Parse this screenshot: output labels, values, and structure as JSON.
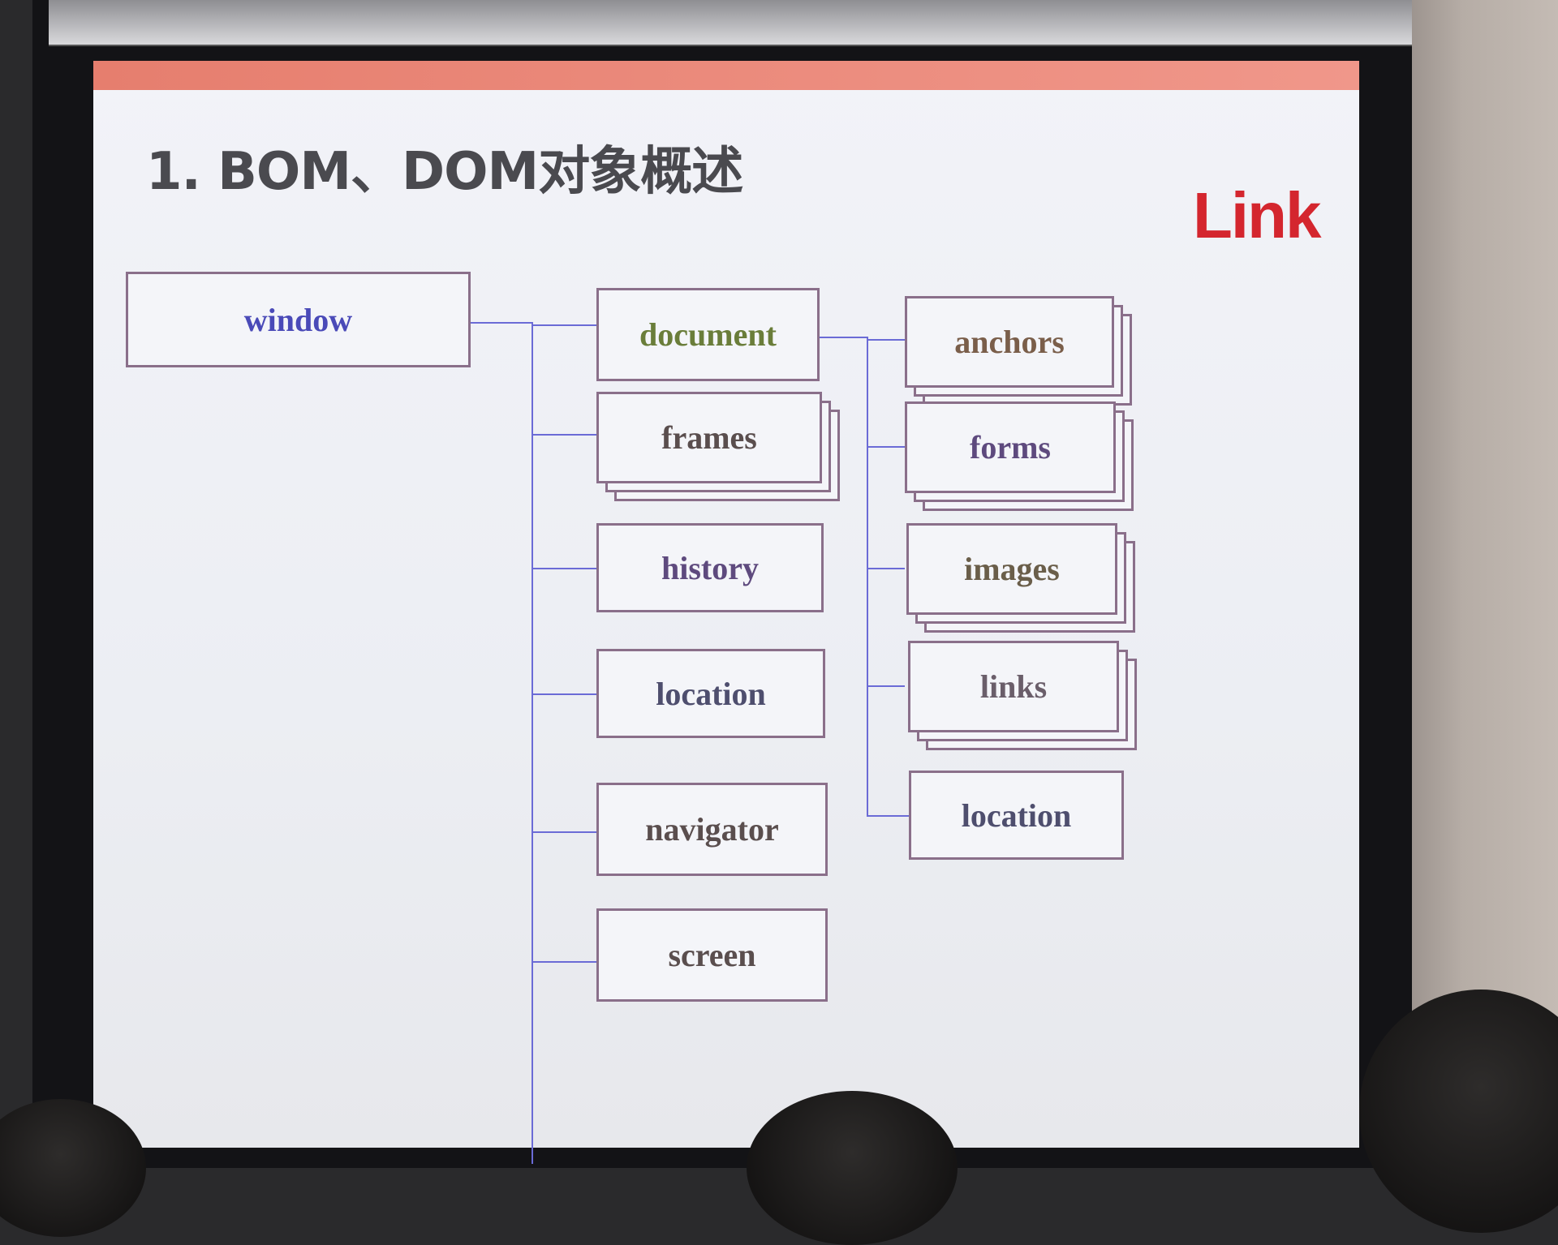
{
  "slide": {
    "title": "1. BOM、DOM对象概述",
    "logo": "Link",
    "accent_color": "#e67e6e",
    "logo_color": "#d4262e",
    "connector_color": "#6b6bd6"
  },
  "diagram": {
    "root": {
      "label": "window",
      "color": "#4a4ab8"
    },
    "window_children": [
      {
        "label": "document",
        "color": "#6a7d3a"
      },
      {
        "label": "frames",
        "color": "#5a4e4e"
      },
      {
        "label": "history",
        "color": "#5e4a7e"
      },
      {
        "label": "location",
        "color": "#4e4e6e"
      },
      {
        "label": "navigator",
        "color": "#5a4e4e"
      },
      {
        "label": "screen",
        "color": "#5a4e4e"
      }
    ],
    "document_children": [
      {
        "label": "anchors",
        "color": "#7a5e4a"
      },
      {
        "label": "forms",
        "color": "#5e4a7e"
      },
      {
        "label": "images",
        "color": "#6a5e4a"
      },
      {
        "label": "links",
        "color": "#6a5e6a"
      },
      {
        "label": "location",
        "color": "#4e4e6e"
      }
    ]
  }
}
